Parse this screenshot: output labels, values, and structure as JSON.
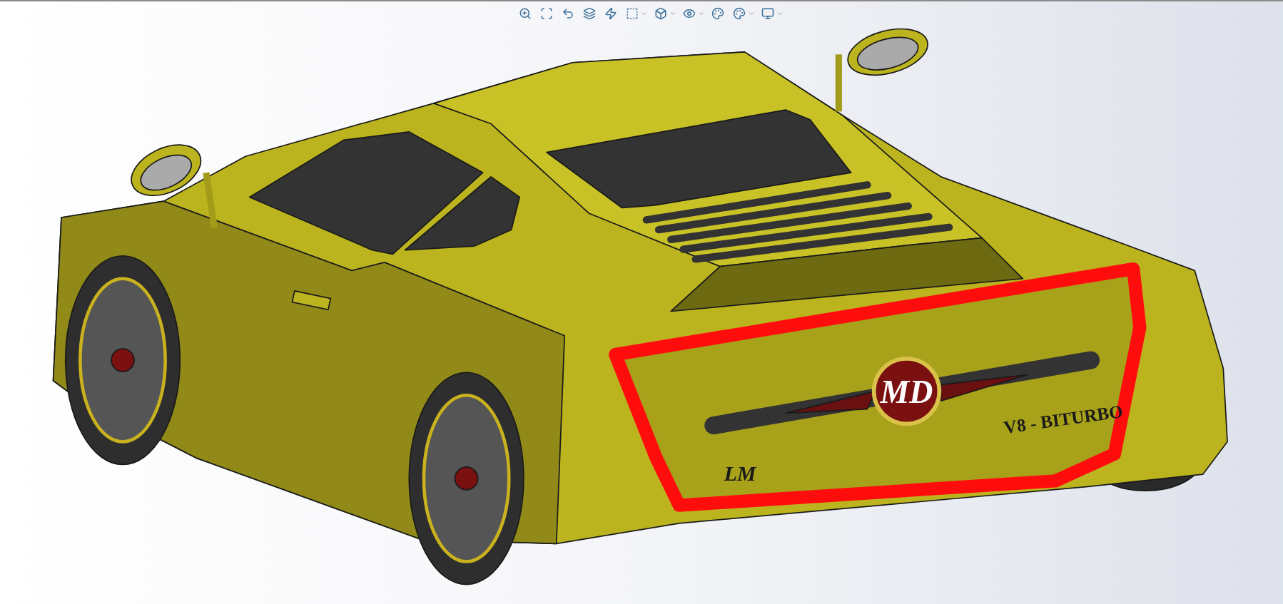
{
  "viewport": {
    "model_labels": [
      {
        "kind": "emblem",
        "text": "MD"
      },
      {
        "kind": "badge",
        "text": "V8 - BITURBO"
      },
      {
        "kind": "signature",
        "text": "LM"
      }
    ]
  }
}
